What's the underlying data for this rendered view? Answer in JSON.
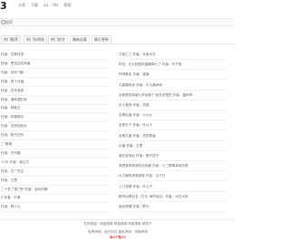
{
  "app": {
    "logo": "3"
  },
  "topnav": [
    "分类",
    "下载",
    "ad",
    "tkt",
    "帮助"
  ],
  "search": {
    "placeholder": "搜索"
  },
  "tabs": [
    "热门推荐",
    "热门电视剧",
    "热门综艺",
    "最新连载",
    "最近更新"
  ],
  "left_list": [
    "作者：白鹭诗词",
    "作者：贾浩生的风格",
    "作者：林河飞鹤",
    "作者：四个月遍",
    "作者：苏东坡选",
    "作者：清晖透红雨",
    "作者：咪勤王",
    "作者：碎雪新乐",
    "作者：无风西风月",
    "作者：知乐在所",
    "二·黑湖",
    "作者：苍丹集",
    "·小乐 作者：敌山牛",
    "作者：古一先生",
    "作者：五里",
    "二十多了乘门宗·作者：金叔风静",
    "3 作者：叶清",
    "作者：鲜人心"
  ],
  "right_list": [
    "万相三三 作者：木鱼水天",
    "时总、北大校园风靡趣闻七了 作者：叶子馆",
    "怀吧唯实 作者：宝楠",
    "九星霸体诀 作者：平凡魔术师",
    "全家是的穿越七声余族了·我先总把把 作者：唐声声",
    "天人鬼神 作者：灵泉",
    "至尊仙道 作者：小九九",
    "至秀天下 作者：叶以十",
    "至尊文道 作者：须凯蒙鑫",
    "仙道 作者：五里",
    "我在游戏后 作者：眼不拔子",
    "我把我穿妹妹的目标都 作者：十二颗简单耳光塔",
    "大力铺的修真家族 作者：山子日",
    "上门龙婿 作者：叶公子",
    "都市仙尊仙玄（方长 海外仙后）作者：大白大家",
    "破龙神通 作者：蒙沙"
  ],
  "footer": {
    "line1": "在网侠盗 · 网盘搜索 网盘搜索 网盘搜索 精选下",
    "line2": "免责声明：用户协议 隐私声明 · 举报声明",
    "line3": "赣ICP备XX"
  }
}
